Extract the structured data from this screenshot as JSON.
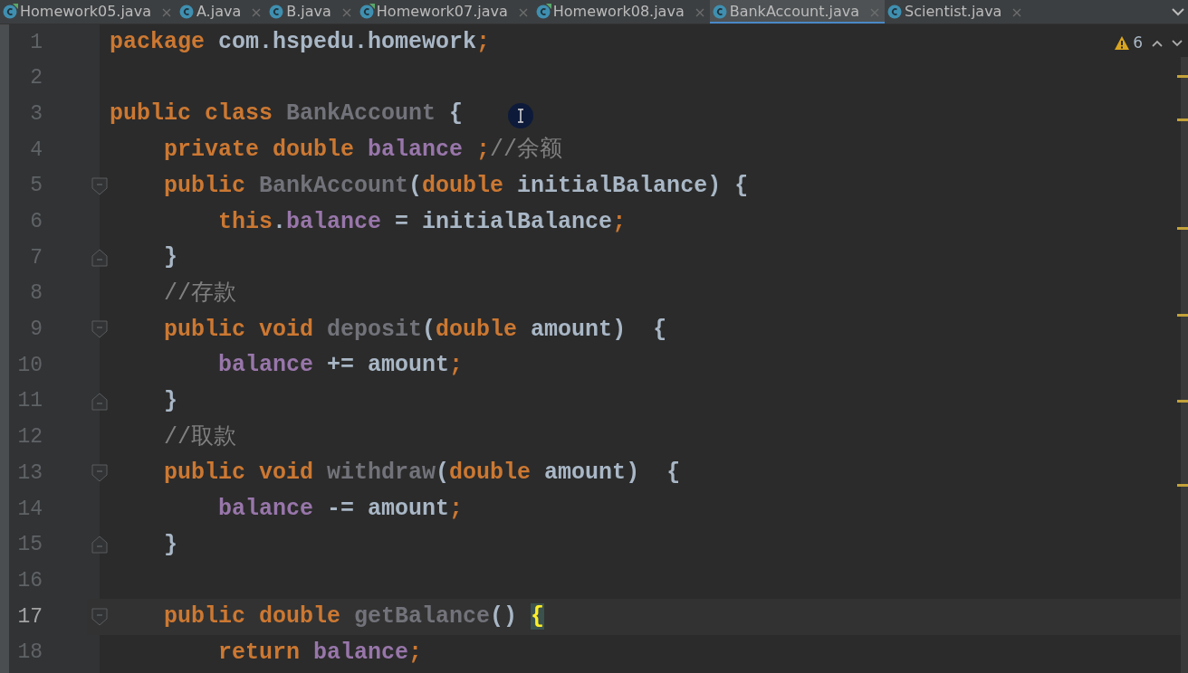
{
  "tabs": [
    {
      "label": "Homework05.java",
      "runnable": true,
      "selected": false
    },
    {
      "label": "A.java",
      "runnable": false,
      "selected": false
    },
    {
      "label": "B.java",
      "runnable": false,
      "selected": false
    },
    {
      "label": "Homework07.java",
      "runnable": true,
      "selected": false
    },
    {
      "label": "Homework08.java",
      "runnable": true,
      "selected": false
    },
    {
      "label": "BankAccount.java",
      "runnable": false,
      "selected": true
    },
    {
      "label": "Scientist.java",
      "runnable": false,
      "selected": false
    }
  ],
  "inspections": {
    "warnings": "6"
  },
  "lines": [
    {
      "number": "1",
      "current": false,
      "tokens": [
        {
          "kind": "keyword",
          "text": "package"
        },
        {
          "kind": "plain",
          "text": " com.hspedu.homework"
        },
        {
          "kind": "keyword",
          "text": ";"
        }
      ]
    },
    {
      "number": "2",
      "current": false
    },
    {
      "number": "3",
      "current": false,
      "tokens": [
        {
          "kind": "keyword",
          "text": "public class "
        },
        {
          "kind": "unused",
          "text": "BankAccount"
        },
        {
          "kind": "plain",
          "text": " {"
        }
      ]
    },
    {
      "number": "4",
      "current": false,
      "tokens": [
        {
          "kind": "keyword",
          "text": "    private double "
        },
        {
          "kind": "field",
          "text": "balance"
        },
        {
          "kind": "keyword",
          "text": " ;"
        },
        {
          "kind": "comment",
          "text": "//余额"
        }
      ]
    },
    {
      "number": "5",
      "kind": "fold-start",
      "current": false,
      "tokens": [
        {
          "kind": "keyword",
          "text": "    public "
        },
        {
          "kind": "unused",
          "text": "BankAccount"
        },
        {
          "kind": "plain",
          "text": "("
        },
        {
          "kind": "keyword",
          "text": "double"
        },
        {
          "kind": "plain",
          "text": " initialBalance) {"
        }
      ]
    },
    {
      "number": "6",
      "current": false,
      "tokens": [
        {
          "kind": "keyword",
          "text": "        this"
        },
        {
          "kind": "plain",
          "text": "."
        },
        {
          "kind": "field",
          "text": "balance"
        },
        {
          "kind": "plain",
          "text": " = initialBalance"
        },
        {
          "kind": "keyword",
          "text": ";"
        }
      ]
    },
    {
      "number": "7",
      "kind": "fold-end",
      "current": false,
      "tokens": [
        {
          "kind": "plain",
          "text": "    }"
        }
      ]
    },
    {
      "number": "8",
      "current": false,
      "tokens": [
        {
          "kind": "comment",
          "text": "    //存款"
        }
      ]
    },
    {
      "number": "9",
      "kind": "fold-start",
      "current": false,
      "tokens": [
        {
          "kind": "keyword",
          "text": "    public void "
        },
        {
          "kind": "unused",
          "text": "deposit"
        },
        {
          "kind": "plain",
          "text": "("
        },
        {
          "kind": "keyword",
          "text": "double"
        },
        {
          "kind": "plain",
          "text": " amount)  {"
        }
      ]
    },
    {
      "number": "10",
      "current": false,
      "tokens": [
        {
          "kind": "field",
          "text": "        balance"
        },
        {
          "kind": "plain",
          "text": " += amount"
        },
        {
          "kind": "keyword",
          "text": ";"
        }
      ]
    },
    {
      "number": "11",
      "kind": "fold-end",
      "current": false,
      "tokens": [
        {
          "kind": "plain",
          "text": "    }"
        }
      ]
    },
    {
      "number": "12",
      "current": false,
      "tokens": [
        {
          "kind": "comment",
          "text": "    //取款"
        }
      ]
    },
    {
      "number": "13",
      "kind": "fold-start",
      "current": false,
      "tokens": [
        {
          "kind": "keyword",
          "text": "    public void "
        },
        {
          "kind": "unused",
          "text": "withdraw"
        },
        {
          "kind": "plain",
          "text": "("
        },
        {
          "kind": "keyword",
          "text": "double"
        },
        {
          "kind": "plain",
          "text": " amount)  {"
        }
      ]
    },
    {
      "number": "14",
      "current": false,
      "tokens": [
        {
          "kind": "field",
          "text": "        balance"
        },
        {
          "kind": "plain",
          "text": " -= amount"
        },
        {
          "kind": "keyword",
          "text": ";"
        }
      ]
    },
    {
      "number": "15",
      "kind": "fold-end",
      "current": false,
      "tokens": [
        {
          "kind": "plain",
          "text": "    }"
        }
      ]
    },
    {
      "number": "16",
      "current": false
    },
    {
      "number": "17",
      "kind": "fold-start",
      "current": true,
      "tokens": [
        {
          "kind": "keyword",
          "text": "    public double "
        },
        {
          "kind": "unused",
          "text": "getBalance"
        },
        {
          "kind": "plain",
          "text": "() "
        },
        {
          "kind": "brace-match",
          "text": "{"
        }
      ]
    },
    {
      "number": "18",
      "current": false,
      "tokens": [
        {
          "kind": "keyword",
          "text": "        return "
        },
        {
          "kind": "field",
          "text": "balance"
        },
        {
          "kind": "keyword",
          "text": ";"
        }
      ]
    }
  ]
}
